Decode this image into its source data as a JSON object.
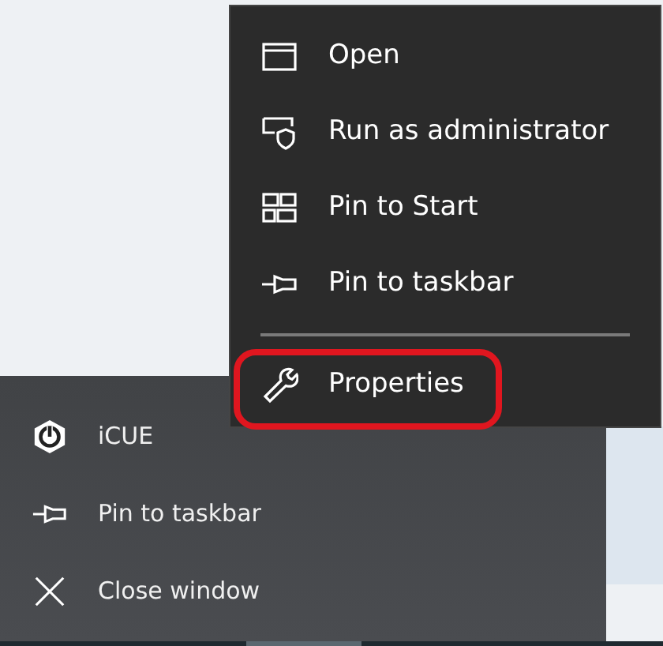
{
  "jump_list": {
    "items": [
      {
        "kind": "app",
        "label": "iCUE"
      },
      {
        "kind": "pin",
        "label": "Pin to taskbar"
      },
      {
        "kind": "close",
        "label": "Close window"
      }
    ]
  },
  "context_menu": {
    "items": [
      {
        "kind": "window",
        "label": "Open",
        "highlighted": false
      },
      {
        "kind": "shield",
        "label": "Run as administrator",
        "highlighted": false
      },
      {
        "kind": "tiles",
        "label": "Pin to Start",
        "highlighted": false
      },
      {
        "kind": "pin",
        "label": "Pin to taskbar",
        "highlighted": false
      },
      {
        "kind": "separator"
      },
      {
        "kind": "wrench",
        "label": "Properties",
        "highlighted": true
      }
    ]
  }
}
